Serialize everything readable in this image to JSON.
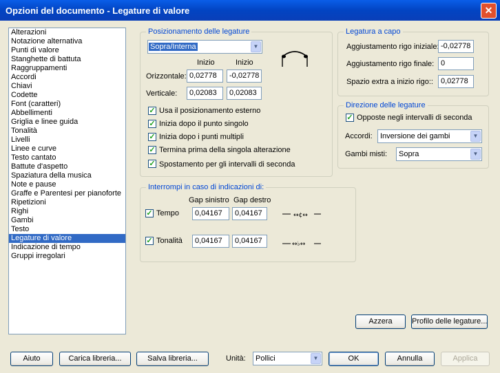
{
  "window": {
    "title": "Opzioni del documento - Legature di valore",
    "close_symbol": "✕"
  },
  "sidebar": {
    "items": [
      "Alterazioni",
      "Notazione alternativa",
      "Punti di valore",
      "Stanghette di battuta",
      "Raggruppamenti",
      "Accordi",
      "Chiavi",
      "Codette",
      "Font (caratteri)",
      "Abbellimenti",
      "Griglia e linee guida",
      "Tonalità",
      "Livelli",
      "Linee e curve",
      "Testo cantato",
      "Battute d'aspetto",
      "Spaziatura della musica",
      "Note e pause",
      "Graffe e Parentesi per pianoforte",
      "Ripetizioni",
      "Righi",
      "Gambi",
      "Testo",
      "Legature di valore",
      "Indicazione di tempo",
      "Gruppi irregolari"
    ],
    "selected": "Legature di valore"
  },
  "positioning": {
    "legend": "Posizionamento delle legature",
    "dropdown_value": "Sopra/Interna",
    "col1": "Inizio",
    "col2": "Inizio",
    "horizontal_label": "Orizzontale:",
    "h1": "0,02778",
    "h2": "-0,02778",
    "vertical_label": "Verticale:",
    "v1": "0,02083",
    "v2": "0,02083",
    "checks": [
      "Usa il posizionamento esterno",
      "Inizia dopo il punto singolo",
      "Inizia dopo i punti multipli",
      "Termina prima della singola alterazione",
      "Spostamento per gli intervalli di seconda"
    ]
  },
  "line_break": {
    "legend": "Legatura a capo",
    "initial_label": "Aggiustamento rigo iniziale:",
    "initial_value": "-0,02778",
    "final_label": "Aggiustamento rigo finale:",
    "final_value": "0",
    "extra_label": "Spazio extra a inizio rigo::",
    "extra_value": "0,02778"
  },
  "direction": {
    "legend": "Direzione delle legature",
    "opposite_label": "Opposte negli intervalli di seconda",
    "chords_label": "Accordi:",
    "chords_value": "Inversione dei gambi",
    "mixed_label": "Gambi misti:",
    "mixed_value": "Sopra"
  },
  "interrupt": {
    "legend": "Interrompi in caso di indicazioni di:",
    "gap_left_header": "Gap sinistro",
    "gap_right_header": "Gap destro",
    "tempo_label": "Tempo",
    "tempo_left": "0,04167",
    "tempo_right": "0,04167",
    "key_label": "Tonalità",
    "key_left": "0,04167",
    "key_right": "0,04167"
  },
  "buttons": {
    "reset": "Azzera",
    "profile": "Profilo delle legature...",
    "help": "Aiuto",
    "load": "Carica libreria...",
    "save": "Salva libreria...",
    "units_label": "Unità:",
    "units_value": "Pollici",
    "ok": "OK",
    "cancel": "Annulla",
    "apply": "Applica"
  },
  "colors": {
    "title_bar": "#0a5ee8",
    "accent": "#316ac5",
    "legend_text": "#0046d5",
    "check": "#21a121"
  }
}
